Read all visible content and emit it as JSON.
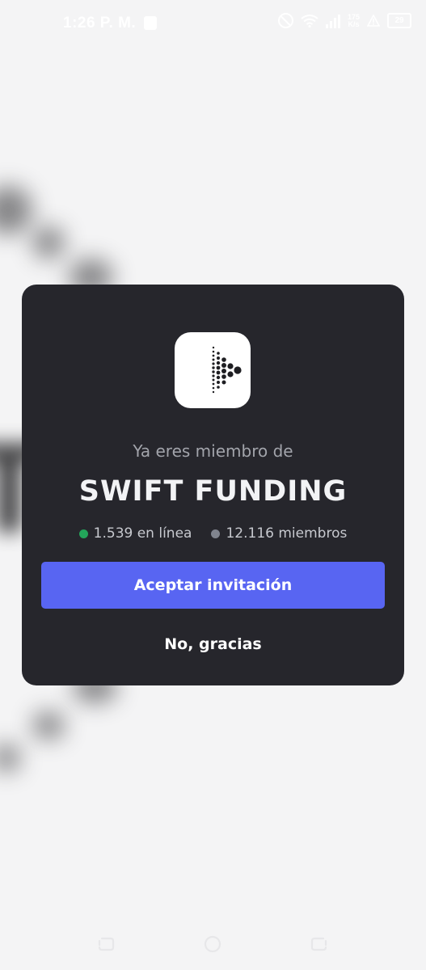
{
  "status_bar": {
    "time": "1:26 P. M.",
    "network_speed_top": "175",
    "network_speed_bottom": "K/s",
    "battery": "29"
  },
  "dialog": {
    "subtitle": "Ya eres miembro de",
    "server_name": "SWIFT FUNDING",
    "online_text": "1.539 en línea",
    "members_text": "12.116 miembros",
    "accept_label": "Aceptar invitación",
    "decline_label": "No, gracias"
  },
  "icons": {
    "server": "swift-funding-logo-icon",
    "online": "online-dot-icon",
    "members": "members-dot-icon",
    "nav_back": "back-icon",
    "nav_home": "home-icon",
    "nav_recent": "recent-apps-icon"
  },
  "colors": {
    "dialog_bg": "#26262c",
    "accent": "#5865f2",
    "online": "#23a55a",
    "members": "#80848e",
    "subtitle": "#a2a4ab"
  }
}
